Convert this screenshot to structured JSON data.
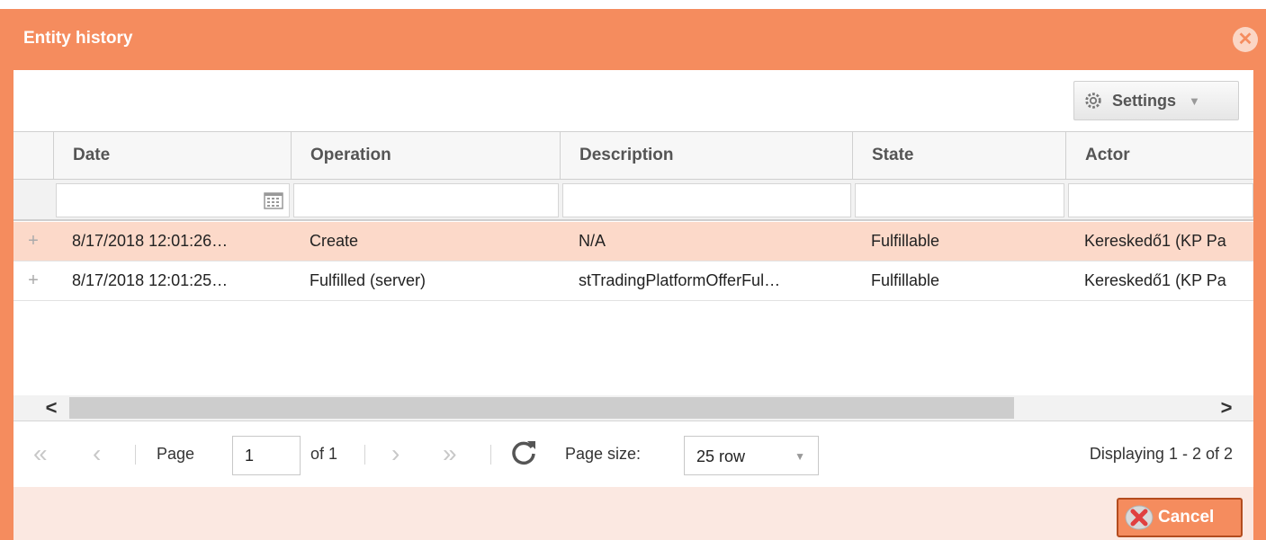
{
  "window": {
    "title": "Entity history"
  },
  "toolbar": {
    "settings_label": "Settings"
  },
  "grid": {
    "columns": [
      "Date",
      "Operation",
      "Description",
      "State",
      "Actor"
    ],
    "rows": [
      {
        "date": "8/17/2018 12:01:26…",
        "operation": "Create",
        "description": "N/A",
        "state": "Fulfillable",
        "actor": "Kereskedő1 (KP Pa"
      },
      {
        "date": "8/17/2018 12:01:25…",
        "operation": "Fulfilled (server)",
        "description": "stTradingPlatformOfferFul…",
        "state": "Fulfillable",
        "actor": "Kereskedő1 (KP Pa"
      }
    ]
  },
  "pager": {
    "page_label": "Page",
    "page_value": "1",
    "of_label": "of 1",
    "page_size_label": "Page size:",
    "page_size_value": "25 row",
    "display_info": "Displaying 1 - 2 of 2"
  },
  "footer": {
    "cancel_label": "Cancel"
  },
  "colors": {
    "accent": "#f58c5e",
    "selected_row": "#fcd9c9",
    "footer_bg": "#fbe8e1"
  }
}
